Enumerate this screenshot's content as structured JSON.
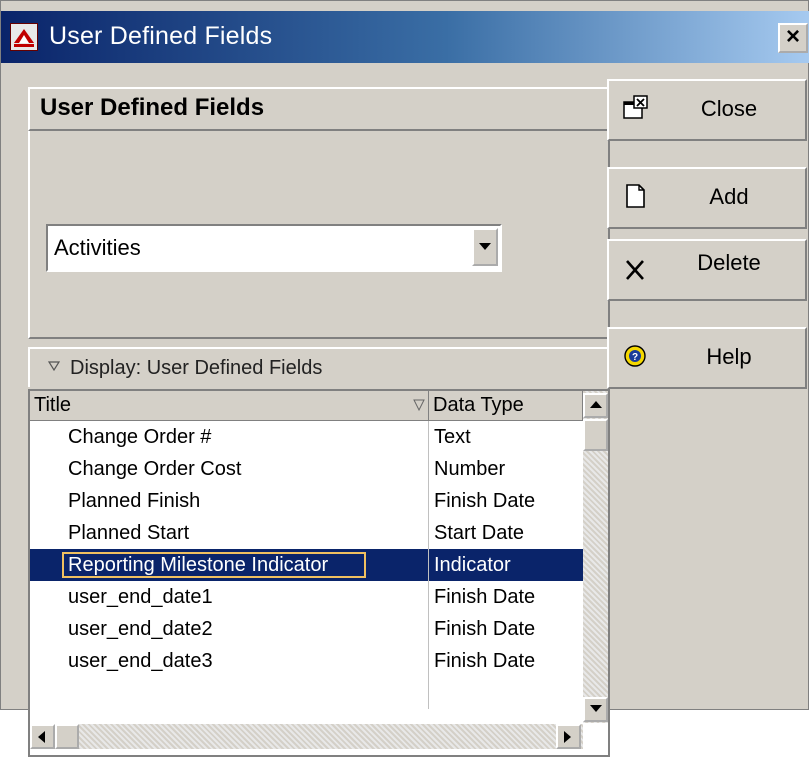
{
  "window": {
    "title": "User Defined Fields",
    "close_glyph": "×"
  },
  "panel": {
    "header_title": "User Defined Fields",
    "subject_area": {
      "selected": "Activities"
    }
  },
  "display": {
    "label": "Display: User Defined Fields"
  },
  "grid": {
    "columns": [
      "Title",
      "Data Type"
    ],
    "rows": [
      {
        "title": "Change Order #",
        "type": "Text"
      },
      {
        "title": "Change Order Cost",
        "type": "Number"
      },
      {
        "title": "Planned Finish",
        "type": "Finish Date"
      },
      {
        "title": "Planned Start",
        "type": "Start Date"
      },
      {
        "title": "Reporting Milestone Indicator",
        "type": "Indicator"
      },
      {
        "title": "user_end_date1",
        "type": "Finish Date"
      },
      {
        "title": "user_end_date2",
        "type": "Finish Date"
      },
      {
        "title": "user_end_date3",
        "type": "Finish Date"
      }
    ],
    "selected_row": "Reporting Milestone Indicator"
  },
  "buttons": {
    "close": {
      "label": "Close",
      "icon": "close-window-icon"
    },
    "add": {
      "label": "Add",
      "icon": "new-document-icon"
    },
    "delete": {
      "label": "Delete",
      "icon": "x-delete-icon"
    },
    "help": {
      "label": "Help",
      "icon": "help-question-icon"
    }
  },
  "colors": {
    "title_bar": "#0a246a",
    "selection": "#0a246a",
    "face": "#d4d0c8"
  }
}
